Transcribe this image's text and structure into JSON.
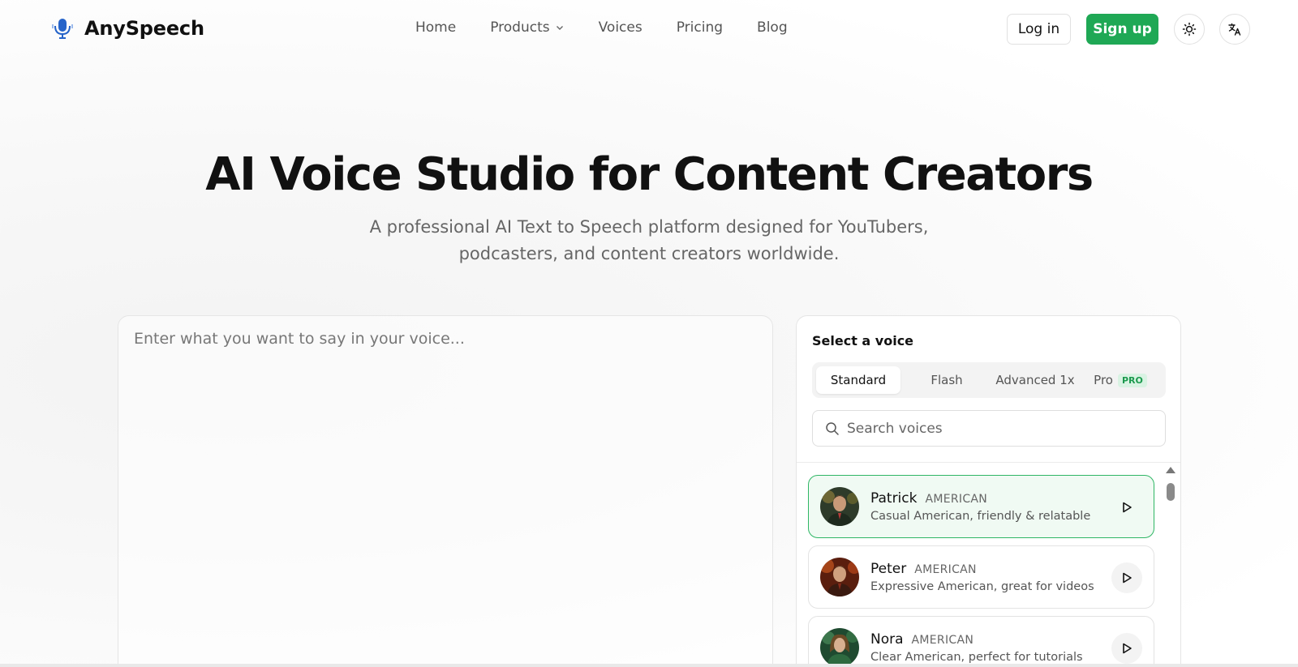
{
  "brand": {
    "name": "AnySpeech"
  },
  "nav": {
    "items": [
      {
        "label": "Home"
      },
      {
        "label": "Products"
      },
      {
        "label": "Voices"
      },
      {
        "label": "Pricing"
      },
      {
        "label": "Blog"
      }
    ],
    "login": "Log in",
    "signup": "Sign up"
  },
  "hero": {
    "title": "AI Voice Studio for Content Creators",
    "subtitle_line1": "A professional AI Text to Speech platform designed for YouTubers,",
    "subtitle_line2": "podcasters, and content creators worldwide."
  },
  "editor": {
    "placeholder": "Enter what you want to say in your voice..."
  },
  "voice_panel": {
    "title": "Select a voice",
    "tabs": [
      {
        "label": "Standard",
        "active": true
      },
      {
        "label": "Flash"
      },
      {
        "label": "Advanced 1x"
      },
      {
        "label": "Pro",
        "badge": "PRO"
      }
    ],
    "search_placeholder": "Search voices",
    "voices": [
      {
        "name": "Patrick",
        "accent": "AMERICAN",
        "desc": "Casual American, friendly & relatable",
        "selected": true
      },
      {
        "name": "Peter",
        "accent": "AMERICAN",
        "desc": "Expressive American, great for videos"
      },
      {
        "name": "Nora",
        "accent": "AMERICAN",
        "desc": "Clear American, perfect for tutorials"
      }
    ]
  },
  "colors": {
    "accent": "#1fa855",
    "selected_border": "#2fb665",
    "selected_bg": "#f0faf3",
    "brand_icon": "#2563c9"
  },
  "icons": {
    "theme": "sun-icon",
    "language": "translate-icon",
    "search": "search-icon",
    "play": "play-icon",
    "brand": "microphone-icon"
  }
}
